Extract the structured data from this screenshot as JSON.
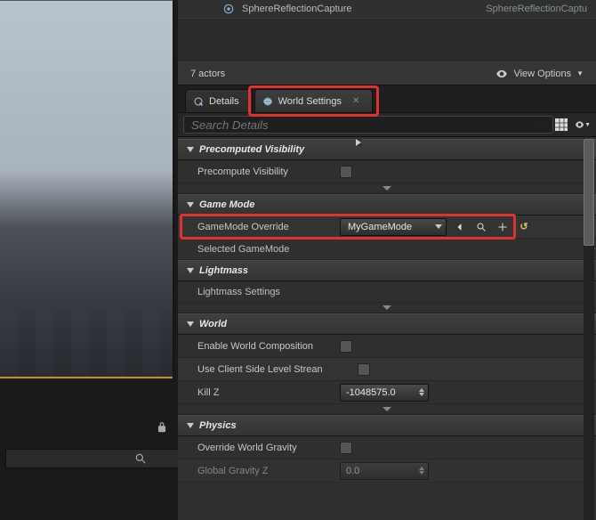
{
  "outliner": {
    "row_label": "SphereReflectionCapture",
    "row_class": "SphereReflectionCaptu",
    "footer_count": "7 actors",
    "view_options": "View Options"
  },
  "tabs": {
    "details": "Details",
    "world_settings": "World Settings"
  },
  "search": {
    "placeholder": "Search Details"
  },
  "sections": {
    "precomputed": {
      "title": "Precomputed Visibility",
      "precompute_label": "Precompute Visibility"
    },
    "gamemode": {
      "title": "Game Mode",
      "override_label": "GameMode Override",
      "override_value": "MyGameMode",
      "selected_label": "Selected GameMode"
    },
    "lightmass": {
      "title": "Lightmass",
      "settings_label": "Lightmass Settings"
    },
    "world": {
      "title": "World",
      "enable_comp": "Enable World Composition",
      "use_client": "Use Client Side Level Strean",
      "killz_label": "Kill Z",
      "killz_value": "-1048575.0"
    },
    "physics": {
      "title": "Physics",
      "override_gravity": "Override World Gravity",
      "global_gravity": "Global Gravity Z",
      "global_gravity_value": "0.0"
    }
  }
}
